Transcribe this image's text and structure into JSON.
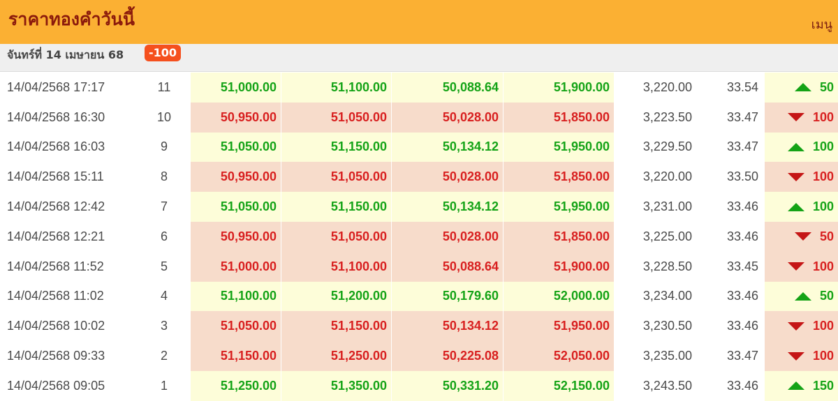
{
  "header": {
    "title": "ราคาทองคำวันนี้",
    "menu_label": "เมนู"
  },
  "date_band": {
    "date_label": "จันทร์ที่ 14 เมษายน 68",
    "change_badge": "-100"
  },
  "colors": {
    "header_bg": "#fbb033",
    "up_text": "#14a316",
    "down_text": "#d81f1f",
    "up_bg": "#fdfdd9",
    "down_bg": "#f7dccb",
    "badge_bg": "#f5501e"
  },
  "rows": [
    {
      "time": "14/04/2568 17:17",
      "index": "11",
      "bar_buy": "51,000.00",
      "bar_sell": "51,100.00",
      "ornament_buy": "50,088.64",
      "ornament_sell": "51,900.00",
      "gold_spot": "3,220.00",
      "thb": "33.54",
      "direction": "up",
      "change": "50"
    },
    {
      "time": "14/04/2568 16:30",
      "index": "10",
      "bar_buy": "50,950.00",
      "bar_sell": "51,050.00",
      "ornament_buy": "50,028.00",
      "ornament_sell": "51,850.00",
      "gold_spot": "3,223.50",
      "thb": "33.47",
      "direction": "down",
      "change": "100"
    },
    {
      "time": "14/04/2568 16:03",
      "index": "9",
      "bar_buy": "51,050.00",
      "bar_sell": "51,150.00",
      "ornament_buy": "50,134.12",
      "ornament_sell": "51,950.00",
      "gold_spot": "3,229.50",
      "thb": "33.47",
      "direction": "up",
      "change": "100"
    },
    {
      "time": "14/04/2568 15:11",
      "index": "8",
      "bar_buy": "50,950.00",
      "bar_sell": "51,050.00",
      "ornament_buy": "50,028.00",
      "ornament_sell": "51,850.00",
      "gold_spot": "3,220.00",
      "thb": "33.50",
      "direction": "down",
      "change": "100"
    },
    {
      "time": "14/04/2568 12:42",
      "index": "7",
      "bar_buy": "51,050.00",
      "bar_sell": "51,150.00",
      "ornament_buy": "50,134.12",
      "ornament_sell": "51,950.00",
      "gold_spot": "3,231.00",
      "thb": "33.46",
      "direction": "up",
      "change": "100"
    },
    {
      "time": "14/04/2568 12:21",
      "index": "6",
      "bar_buy": "50,950.00",
      "bar_sell": "51,050.00",
      "ornament_buy": "50,028.00",
      "ornament_sell": "51,850.00",
      "gold_spot": "3,225.00",
      "thb": "33.46",
      "direction": "down",
      "change": "50"
    },
    {
      "time": "14/04/2568 11:52",
      "index": "5",
      "bar_buy": "51,000.00",
      "bar_sell": "51,100.00",
      "ornament_buy": "50,088.64",
      "ornament_sell": "51,900.00",
      "gold_spot": "3,228.50",
      "thb": "33.45",
      "direction": "down",
      "change": "100"
    },
    {
      "time": "14/04/2568 11:02",
      "index": "4",
      "bar_buy": "51,100.00",
      "bar_sell": "51,200.00",
      "ornament_buy": "50,179.60",
      "ornament_sell": "52,000.00",
      "gold_spot": "3,234.00",
      "thb": "33.46",
      "direction": "up",
      "change": "50"
    },
    {
      "time": "14/04/2568 10:02",
      "index": "3",
      "bar_buy": "51,050.00",
      "bar_sell": "51,150.00",
      "ornament_buy": "50,134.12",
      "ornament_sell": "51,950.00",
      "gold_spot": "3,230.50",
      "thb": "33.46",
      "direction": "down",
      "change": "100"
    },
    {
      "time": "14/04/2568 09:33",
      "index": "2",
      "bar_buy": "51,150.00",
      "bar_sell": "51,250.00",
      "ornament_buy": "50,225.08",
      "ornament_sell": "52,050.00",
      "gold_spot": "3,235.00",
      "thb": "33.47",
      "direction": "down",
      "change": "100"
    },
    {
      "time": "14/04/2568 09:05",
      "index": "1",
      "bar_buy": "51,250.00",
      "bar_sell": "51,350.00",
      "ornament_buy": "50,331.20",
      "ornament_sell": "52,150.00",
      "gold_spot": "3,243.50",
      "thb": "33.46",
      "direction": "up",
      "change": "150"
    }
  ]
}
